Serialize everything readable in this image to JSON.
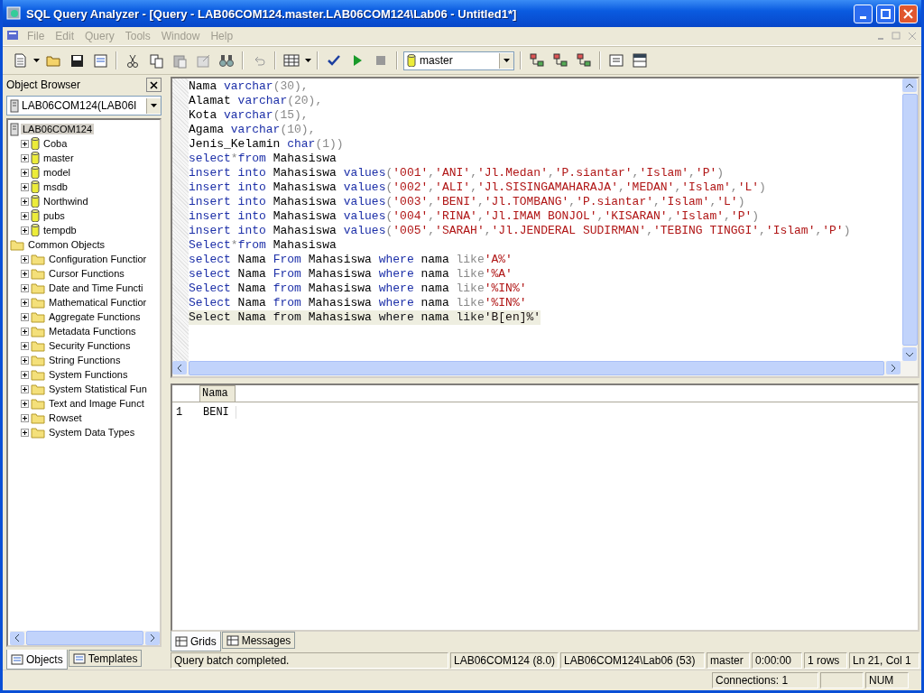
{
  "window": {
    "title": "SQL Query Analyzer - [Query - LAB06COM124.master.LAB06COM124\\Lab06 - Untitled1*]"
  },
  "menu": [
    "File",
    "Edit",
    "Query",
    "Tools",
    "Window",
    "Help"
  ],
  "toolbar": {
    "database": "master"
  },
  "object_browser": {
    "title": "Object Browser",
    "server": "LAB06COM124(LAB06I",
    "tree": [
      {
        "label": "LAB06COM124",
        "kind": "server",
        "expanded": true,
        "selected": true,
        "children": [
          {
            "label": "Coba",
            "kind": "database",
            "expanded": false,
            "selected": false
          },
          {
            "label": "master",
            "kind": "database",
            "expanded": false,
            "selected": false
          },
          {
            "label": "model",
            "kind": "database",
            "expanded": false,
            "selected": false
          },
          {
            "label": "msdb",
            "kind": "database",
            "expanded": false,
            "selected": false
          },
          {
            "label": "Northwind",
            "kind": "database",
            "expanded": false,
            "selected": false
          },
          {
            "label": "pubs",
            "kind": "database",
            "expanded": false,
            "selected": false
          },
          {
            "label": "tempdb",
            "kind": "database",
            "expanded": false,
            "selected": false
          }
        ]
      },
      {
        "label": "Common Objects",
        "kind": "folder",
        "expanded": true,
        "selected": false,
        "children": [
          {
            "label": "Configuration Functior",
            "kind": "folder",
            "expanded": false,
            "selected": false
          },
          {
            "label": "Cursor Functions",
            "kind": "folder",
            "expanded": false,
            "selected": false
          },
          {
            "label": "Date and Time Functi",
            "kind": "folder",
            "expanded": false,
            "selected": false
          },
          {
            "label": "Mathematical Functior",
            "kind": "folder",
            "expanded": false,
            "selected": false
          },
          {
            "label": "Aggregate Functions",
            "kind": "folder",
            "expanded": false,
            "selected": false
          },
          {
            "label": "Metadata Functions",
            "kind": "folder",
            "expanded": false,
            "selected": false
          },
          {
            "label": "Security Functions",
            "kind": "folder",
            "expanded": false,
            "selected": false
          },
          {
            "label": "String Functions",
            "kind": "folder",
            "expanded": false,
            "selected": false
          },
          {
            "label": "System Functions",
            "kind": "folder",
            "expanded": false,
            "selected": false
          },
          {
            "label": "System Statistical Fun",
            "kind": "folder",
            "expanded": false,
            "selected": false
          },
          {
            "label": "Text and Image Funct",
            "kind": "folder",
            "expanded": false,
            "selected": false
          },
          {
            "label": "Rowset",
            "kind": "folder",
            "expanded": false,
            "selected": false
          },
          {
            "label": "System Data Types",
            "kind": "folder",
            "expanded": false,
            "selected": false
          }
        ]
      }
    ],
    "tabs": [
      {
        "label": "Objects",
        "selected": true
      },
      {
        "label": "Templates",
        "selected": false
      }
    ]
  },
  "editor": {
    "lines": [
      {
        "selected": false,
        "tokens": [
          {
            "kind": "plain",
            "text": "Nama "
          },
          {
            "kind": "keyword",
            "text": "varchar"
          },
          {
            "kind": "operator",
            "text": "(30),"
          }
        ]
      },
      {
        "selected": false,
        "tokens": [
          {
            "kind": "plain",
            "text": "Alamat "
          },
          {
            "kind": "keyword",
            "text": "varchar"
          },
          {
            "kind": "operator",
            "text": "(20),"
          }
        ]
      },
      {
        "selected": false,
        "tokens": [
          {
            "kind": "plain",
            "text": "Kota "
          },
          {
            "kind": "keyword",
            "text": "varchar"
          },
          {
            "kind": "operator",
            "text": "(15),"
          }
        ]
      },
      {
        "selected": false,
        "tokens": [
          {
            "kind": "plain",
            "text": "Agama "
          },
          {
            "kind": "keyword",
            "text": "varchar"
          },
          {
            "kind": "operator",
            "text": "(10),"
          }
        ]
      },
      {
        "selected": false,
        "tokens": [
          {
            "kind": "plain",
            "text": "Jenis_Kelamin "
          },
          {
            "kind": "keyword",
            "text": "char"
          },
          {
            "kind": "operator",
            "text": "(1))"
          }
        ]
      },
      {
        "selected": false,
        "tokens": [
          {
            "kind": "keyword",
            "text": "select"
          },
          {
            "kind": "operator",
            "text": "*"
          },
          {
            "kind": "keyword",
            "text": "from"
          },
          {
            "kind": "plain",
            "text": " Mahasiswa"
          }
        ]
      },
      {
        "selected": false,
        "tokens": [
          {
            "kind": "keyword",
            "text": "insert into"
          },
          {
            "kind": "plain",
            "text": " Mahasiswa "
          },
          {
            "kind": "keyword",
            "text": "values"
          },
          {
            "kind": "operator",
            "text": "("
          },
          {
            "kind": "string",
            "text": "'001'"
          },
          {
            "kind": "operator",
            "text": ","
          },
          {
            "kind": "string",
            "text": "'ANI'"
          },
          {
            "kind": "operator",
            "text": ","
          },
          {
            "kind": "string",
            "text": "'Jl.Medan'"
          },
          {
            "kind": "operator",
            "text": ","
          },
          {
            "kind": "string",
            "text": "'P.siantar'"
          },
          {
            "kind": "operator",
            "text": ","
          },
          {
            "kind": "string",
            "text": "'Islam'"
          },
          {
            "kind": "operator",
            "text": ","
          },
          {
            "kind": "string",
            "text": "'P'"
          },
          {
            "kind": "operator",
            "text": ")"
          }
        ]
      },
      {
        "selected": false,
        "tokens": [
          {
            "kind": "keyword",
            "text": "insert into"
          },
          {
            "kind": "plain",
            "text": " Mahasiswa "
          },
          {
            "kind": "keyword",
            "text": "values"
          },
          {
            "kind": "operator",
            "text": "("
          },
          {
            "kind": "string",
            "text": "'002'"
          },
          {
            "kind": "operator",
            "text": ","
          },
          {
            "kind": "string",
            "text": "'ALI'"
          },
          {
            "kind": "operator",
            "text": ","
          },
          {
            "kind": "string",
            "text": "'Jl.SISINGAMAHARAJA'"
          },
          {
            "kind": "operator",
            "text": ","
          },
          {
            "kind": "string",
            "text": "'MEDAN'"
          },
          {
            "kind": "operator",
            "text": ","
          },
          {
            "kind": "string",
            "text": "'Islam'"
          },
          {
            "kind": "operator",
            "text": ","
          },
          {
            "kind": "string",
            "text": "'L'"
          },
          {
            "kind": "operator",
            "text": ")"
          }
        ]
      },
      {
        "selected": false,
        "tokens": [
          {
            "kind": "keyword",
            "text": "insert into"
          },
          {
            "kind": "plain",
            "text": " Mahasiswa "
          },
          {
            "kind": "keyword",
            "text": "values"
          },
          {
            "kind": "operator",
            "text": "("
          },
          {
            "kind": "string",
            "text": "'003'"
          },
          {
            "kind": "operator",
            "text": ","
          },
          {
            "kind": "string",
            "text": "'BENI'"
          },
          {
            "kind": "operator",
            "text": ","
          },
          {
            "kind": "string",
            "text": "'Jl.TOMBANG'"
          },
          {
            "kind": "operator",
            "text": ","
          },
          {
            "kind": "string",
            "text": "'P.siantar'"
          },
          {
            "kind": "operator",
            "text": ","
          },
          {
            "kind": "string",
            "text": "'Islam'"
          },
          {
            "kind": "operator",
            "text": ","
          },
          {
            "kind": "string",
            "text": "'L'"
          },
          {
            "kind": "operator",
            "text": ")"
          }
        ]
      },
      {
        "selected": false,
        "tokens": [
          {
            "kind": "keyword",
            "text": "insert into"
          },
          {
            "kind": "plain",
            "text": " Mahasiswa "
          },
          {
            "kind": "keyword",
            "text": "values"
          },
          {
            "kind": "operator",
            "text": "("
          },
          {
            "kind": "string",
            "text": "'004'"
          },
          {
            "kind": "operator",
            "text": ","
          },
          {
            "kind": "string",
            "text": "'RINA'"
          },
          {
            "kind": "operator",
            "text": ","
          },
          {
            "kind": "string",
            "text": "'Jl.IMAM BONJOL'"
          },
          {
            "kind": "operator",
            "text": ","
          },
          {
            "kind": "string",
            "text": "'KISARAN'"
          },
          {
            "kind": "operator",
            "text": ","
          },
          {
            "kind": "string",
            "text": "'Islam'"
          },
          {
            "kind": "operator",
            "text": ","
          },
          {
            "kind": "string",
            "text": "'P'"
          },
          {
            "kind": "operator",
            "text": ")"
          }
        ]
      },
      {
        "selected": false,
        "tokens": [
          {
            "kind": "keyword",
            "text": "insert into"
          },
          {
            "kind": "plain",
            "text": " Mahasiswa "
          },
          {
            "kind": "keyword",
            "text": "values"
          },
          {
            "kind": "operator",
            "text": "("
          },
          {
            "kind": "string",
            "text": "'005'"
          },
          {
            "kind": "operator",
            "text": ","
          },
          {
            "kind": "string",
            "text": "'SARAH'"
          },
          {
            "kind": "operator",
            "text": ","
          },
          {
            "kind": "string",
            "text": "'Jl.JENDERAL SUDIRMAN'"
          },
          {
            "kind": "operator",
            "text": ","
          },
          {
            "kind": "string",
            "text": "'TEBING TINGGI'"
          },
          {
            "kind": "operator",
            "text": ","
          },
          {
            "kind": "string",
            "text": "'Islam'"
          },
          {
            "kind": "operator",
            "text": ","
          },
          {
            "kind": "string",
            "text": "'P'"
          },
          {
            "kind": "operator",
            "text": ")"
          }
        ]
      },
      {
        "selected": false,
        "tokens": [
          {
            "kind": "keyword",
            "text": "Select"
          },
          {
            "kind": "operator",
            "text": "*"
          },
          {
            "kind": "keyword",
            "text": "from"
          },
          {
            "kind": "plain",
            "text": " Mahasiswa"
          }
        ]
      },
      {
        "selected": false,
        "tokens": [
          {
            "kind": "keyword",
            "text": "select"
          },
          {
            "kind": "plain",
            "text": " Nama "
          },
          {
            "kind": "keyword",
            "text": "From"
          },
          {
            "kind": "plain",
            "text": " Mahasiswa "
          },
          {
            "kind": "keyword",
            "text": "where"
          },
          {
            "kind": "plain",
            "text": " nama "
          },
          {
            "kind": "operator",
            "text": "like"
          },
          {
            "kind": "string",
            "text": "'A%'"
          }
        ]
      },
      {
        "selected": false,
        "tokens": [
          {
            "kind": "keyword",
            "text": "select"
          },
          {
            "kind": "plain",
            "text": " Nama "
          },
          {
            "kind": "keyword",
            "text": "From"
          },
          {
            "kind": "plain",
            "text": " Mahasiswa "
          },
          {
            "kind": "keyword",
            "text": "where"
          },
          {
            "kind": "plain",
            "text": " nama "
          },
          {
            "kind": "operator",
            "text": "like"
          },
          {
            "kind": "string",
            "text": "'%A'"
          }
        ]
      },
      {
        "selected": false,
        "tokens": [
          {
            "kind": "keyword",
            "text": "Select"
          },
          {
            "kind": "plain",
            "text": " Nama "
          },
          {
            "kind": "keyword",
            "text": "from"
          },
          {
            "kind": "plain",
            "text": " Mahasiswa "
          },
          {
            "kind": "keyword",
            "text": "where"
          },
          {
            "kind": "plain",
            "text": " nama "
          },
          {
            "kind": "operator",
            "text": "like"
          },
          {
            "kind": "string",
            "text": "'%IN%'"
          }
        ]
      },
      {
        "selected": false,
        "tokens": [
          {
            "kind": "keyword",
            "text": "Select"
          },
          {
            "kind": "plain",
            "text": " Nama "
          },
          {
            "kind": "keyword",
            "text": "from"
          },
          {
            "kind": "plain",
            "text": " Mahasiswa "
          },
          {
            "kind": "keyword",
            "text": "where"
          },
          {
            "kind": "plain",
            "text": " nama "
          },
          {
            "kind": "operator",
            "text": "like"
          },
          {
            "kind": "string",
            "text": "'%IN%'"
          }
        ]
      },
      {
        "selected": true,
        "tokens": [
          {
            "kind": "keyword",
            "text": "Select"
          },
          {
            "kind": "plain",
            "text": " Nama "
          },
          {
            "kind": "keyword",
            "text": "from"
          },
          {
            "kind": "plain",
            "text": " Mahasiswa "
          },
          {
            "kind": "keyword",
            "text": "where"
          },
          {
            "kind": "plain",
            "text": " nama "
          },
          {
            "kind": "operator",
            "text": "like"
          },
          {
            "kind": "string",
            "text": "'B[en]%'"
          }
        ]
      }
    ]
  },
  "results": {
    "columns": [
      "Nama"
    ],
    "rows": [
      {
        "number": "1",
        "cells": [
          "BENI"
        ]
      }
    ]
  },
  "result_tabs": [
    {
      "label": "Grids",
      "selected": true
    },
    {
      "label": "Messages",
      "selected": false
    }
  ],
  "status_bar": {
    "message": "Query batch completed.",
    "fields": [
      "LAB06COM124 (8.0)",
      "LAB06COM124\\Lab06 (53)",
      "master",
      "0:00:00",
      "1 rows",
      "Ln 21, Col 1"
    ]
  },
  "app_status_bar": {
    "fields": [
      "Connections: 1",
      "NUM"
    ]
  }
}
